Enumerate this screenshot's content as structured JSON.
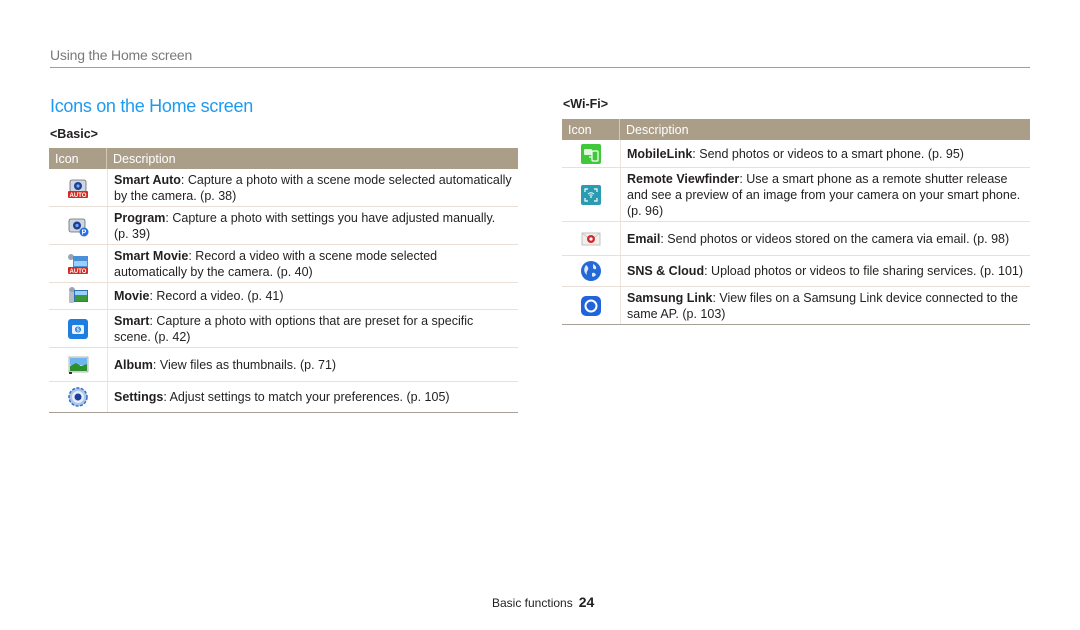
{
  "header": {
    "running_head": "Using the Home screen"
  },
  "section": {
    "title": "Icons on the Home screen"
  },
  "basic": {
    "label": "<Basic>",
    "columns": [
      "Icon",
      "Description"
    ],
    "rows": [
      {
        "icon": "smart-auto-camera-icon",
        "name": "Smart Auto",
        "text": ": Capture a photo with a scene mode selected automatically by the camera. (p. 38)"
      },
      {
        "icon": "program-camera-icon",
        "name": "Program",
        "text": ": Capture a photo with settings you have adjusted manually. (p. 39)"
      },
      {
        "icon": "smart-movie-icon",
        "name": "Smart Movie",
        "text": ": Record a video with a scene mode selected automatically by the camera. (p. 40)"
      },
      {
        "icon": "movie-icon",
        "name": "Movie",
        "text": ": Record a video. (p. 41)"
      },
      {
        "icon": "smart-scene-icon",
        "name": "Smart",
        "text": ": Capture a photo with options that are preset for a specific scene. (p. 42)"
      },
      {
        "icon": "album-icon",
        "name": "Album",
        "text": ": View files as thumbnails. (p. 71)"
      },
      {
        "icon": "settings-gear-icon",
        "name": "Settings",
        "text": ": Adjust settings to match your preferences. (p. 105)"
      }
    ]
  },
  "wifi": {
    "label": "<Wi-Fi>",
    "columns": [
      "Icon",
      "Description"
    ],
    "rows": [
      {
        "icon": "mobilelink-icon",
        "name": "MobileLink",
        "text": ": Send photos or videos to a smart phone. (p. 95)"
      },
      {
        "icon": "remote-viewfinder-icon",
        "name": "Remote Viewfinder",
        "text": ": Use a smart phone as a remote shutter release and see a preview of an image from your camera on your smart phone. (p. 96)"
      },
      {
        "icon": "email-icon",
        "name": "Email",
        "text": ": Send photos or videos stored on the camera via email. (p. 98)"
      },
      {
        "icon": "sns-cloud-globe-icon",
        "name": "SNS & Cloud",
        "text": ": Upload photos or videos to file sharing services. (p. 101)"
      },
      {
        "icon": "samsung-link-icon",
        "name": "Samsung Link",
        "text": ": View files on a Samsung Link device connected to the same AP. (p. 103)"
      }
    ]
  },
  "footer": {
    "section": "Basic functions",
    "page": "24"
  },
  "colors": {
    "title_blue": "#1d9bf0",
    "table_header": "#ab9e89"
  }
}
